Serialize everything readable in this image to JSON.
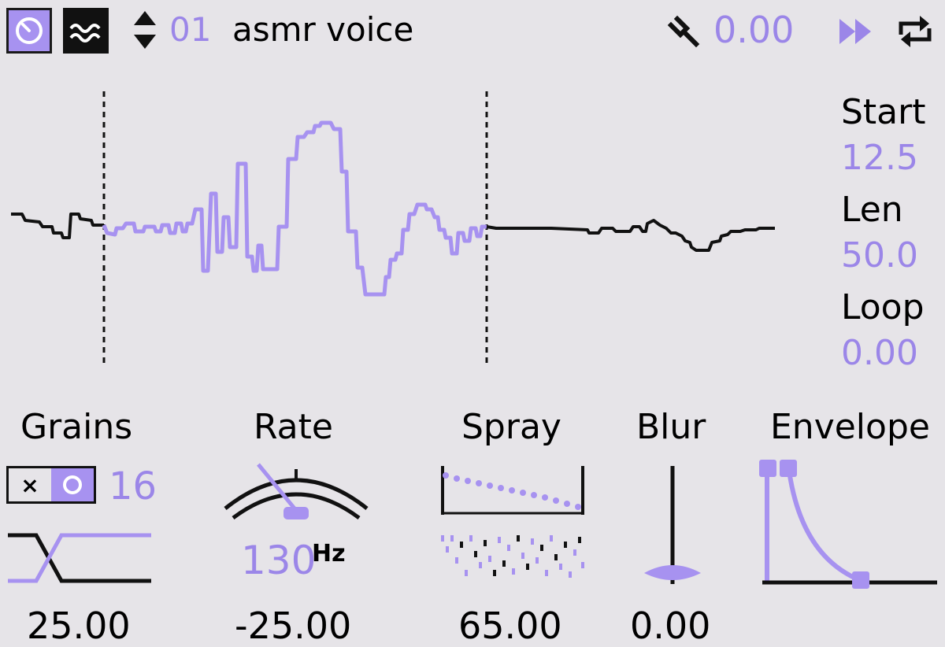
{
  "colors": {
    "accent": "#9b86e8",
    "accent_fill": "#a792f0",
    "ink": "#111111",
    "background": "#e6e4e8"
  },
  "header": {
    "mode_icon": "dial-icon",
    "wave_icon": "wave-icon",
    "preset_arrows_icon": "up-down-arrows-icon",
    "preset_number": "01",
    "preset_name": "asmr voice",
    "tuning_icon": "tuning-fork-icon",
    "tuning_value": "0.00",
    "play_icon": "fast-forward-icon",
    "sync_icon": "sync-icon"
  },
  "sample": {
    "start_label": "Start",
    "start_value": "12.5",
    "len_label": "Len",
    "len_value": "50.0",
    "loop_label": "Loop",
    "loop_value": "0.00"
  },
  "controls": {
    "grains": {
      "label": "Grains",
      "value": "25.00",
      "count": "16",
      "toggle_off": "×"
    },
    "rate": {
      "label": "Rate",
      "value": "-25.00",
      "freq": "130",
      "unit": "Hz"
    },
    "spray": {
      "label": "Spray",
      "value": "65.00"
    },
    "blur": {
      "label": "Blur",
      "value": "0.00"
    },
    "envelope": {
      "label": "Envelope"
    }
  }
}
